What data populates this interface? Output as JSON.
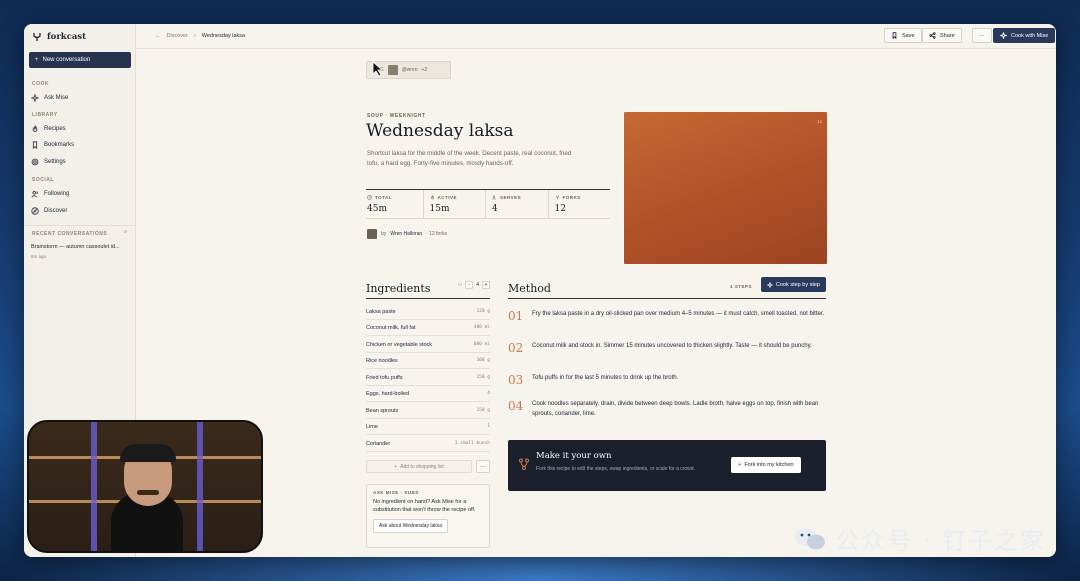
{
  "app": {
    "brand": "forkcast",
    "new_conversation": "New conversation"
  },
  "sidebar": {
    "sections": {
      "cook": "COOK",
      "library": "LIBRARY",
      "social": "SOCIAL",
      "recent": "RECENT CONVERSATIONS"
    },
    "items": [
      {
        "label": "Ask Mise",
        "icon": "sparkle-icon"
      },
      {
        "label": "Recipes",
        "icon": "flame-icon"
      },
      {
        "label": "Bookmarks",
        "icon": "bookmark-icon"
      },
      {
        "label": "Settings",
        "icon": "gear-icon"
      },
      {
        "label": "Following",
        "icon": "users-icon"
      },
      {
        "label": "Discover",
        "icon": "compass-icon"
      }
    ],
    "recent": [
      {
        "title": "Brainstorm — autumn cassoulet id...",
        "time": "8m ago"
      }
    ]
  },
  "topbar": {
    "breadcrumb": [
      "Discover",
      "Wednesday laksa"
    ],
    "save": "Save",
    "share": "Share",
    "more": "···",
    "cook": "Cook with Mise"
  },
  "recipe": {
    "forked_chip": {
      "prefix": "AGE",
      "handle": "@wren",
      "extra": "+2"
    },
    "eyebrow": "SOUP · WEEKNIGHT",
    "title": "Wednesday laksa",
    "description": "Shortcut laksa for the middle of the week. Decent paste, real coconut, fried tofu, a hard egg. Forty-five minutes, mostly hands-off.",
    "stats": [
      {
        "label": "TOTAL",
        "value": "45m"
      },
      {
        "label": "ACTIVE",
        "value": "15m"
      },
      {
        "label": "SERVES",
        "value": "4"
      },
      {
        "label": "FORKS",
        "value": "12"
      }
    ],
    "author": {
      "by": "by",
      "name": "Wren Halloran",
      "forks": "· 12 forks"
    },
    "hero_badge": "1x"
  },
  "ingredients": {
    "title": "Ingredients",
    "serves": "4",
    "minus": "-",
    "plus": "+",
    "items": [
      {
        "name": "Laksa paste",
        "qty": "120 g"
      },
      {
        "name": "Coconut milk, full fat",
        "qty": "400 ml"
      },
      {
        "name": "Chicken or vegetable stock",
        "qty": "600 ml"
      },
      {
        "name": "Rice noodles",
        "qty": "300 g"
      },
      {
        "name": "Fried tofu puffs",
        "qty": "150 g"
      },
      {
        "name": "Eggs, hard-boiled",
        "qty": "4"
      },
      {
        "name": "Bean sprouts",
        "qty": "150 g"
      },
      {
        "name": "Lime",
        "qty": "1"
      },
      {
        "name": "Coriander",
        "qty": "1 small bunch"
      }
    ],
    "shopping": "Add to shopping list",
    "more": "···"
  },
  "mise_card": {
    "label": "ASK MISE · SUBS",
    "text": "No ingredient on hand? Ask Mise for a substitution that won't throw the recipe off.",
    "button": "Ask about Wednesday laksa"
  },
  "method": {
    "title": "Method",
    "count": "4 STEPS",
    "button": "Cook step by step",
    "steps": [
      {
        "num": "01",
        "text": "Fry the laksa paste in a dry oil-slicked pan over medium 4–5 minutes — it must catch, smell toasted, not bitter."
      },
      {
        "num": "02",
        "text": "Coconut milk and stock in. Simmer 15 minutes uncovered to thicken slightly. Taste — it should be punchy."
      },
      {
        "num": "03",
        "text": "Tofu puffs in for the last 5 minutes to drink up the broth."
      },
      {
        "num": "04",
        "text": "Cook noodles separately, drain, divide between deep bowls. Ladle broth, halve eggs on top, finish with bean sprouts, coriander, lime."
      }
    ]
  },
  "fork_card": {
    "title": "Make it your own",
    "text": "Fork this recipe to edit the steps, swap ingredients, or scale for a crowd.",
    "button": "Fork into my kitchen"
  },
  "watermark": {
    "text": "公众号 · 钉子之家"
  },
  "colors": {
    "accent": "#2a3a5c",
    "hero": "#b4552a",
    "step_num": "#c77a52",
    "dark_card": "#1b1f2b"
  }
}
